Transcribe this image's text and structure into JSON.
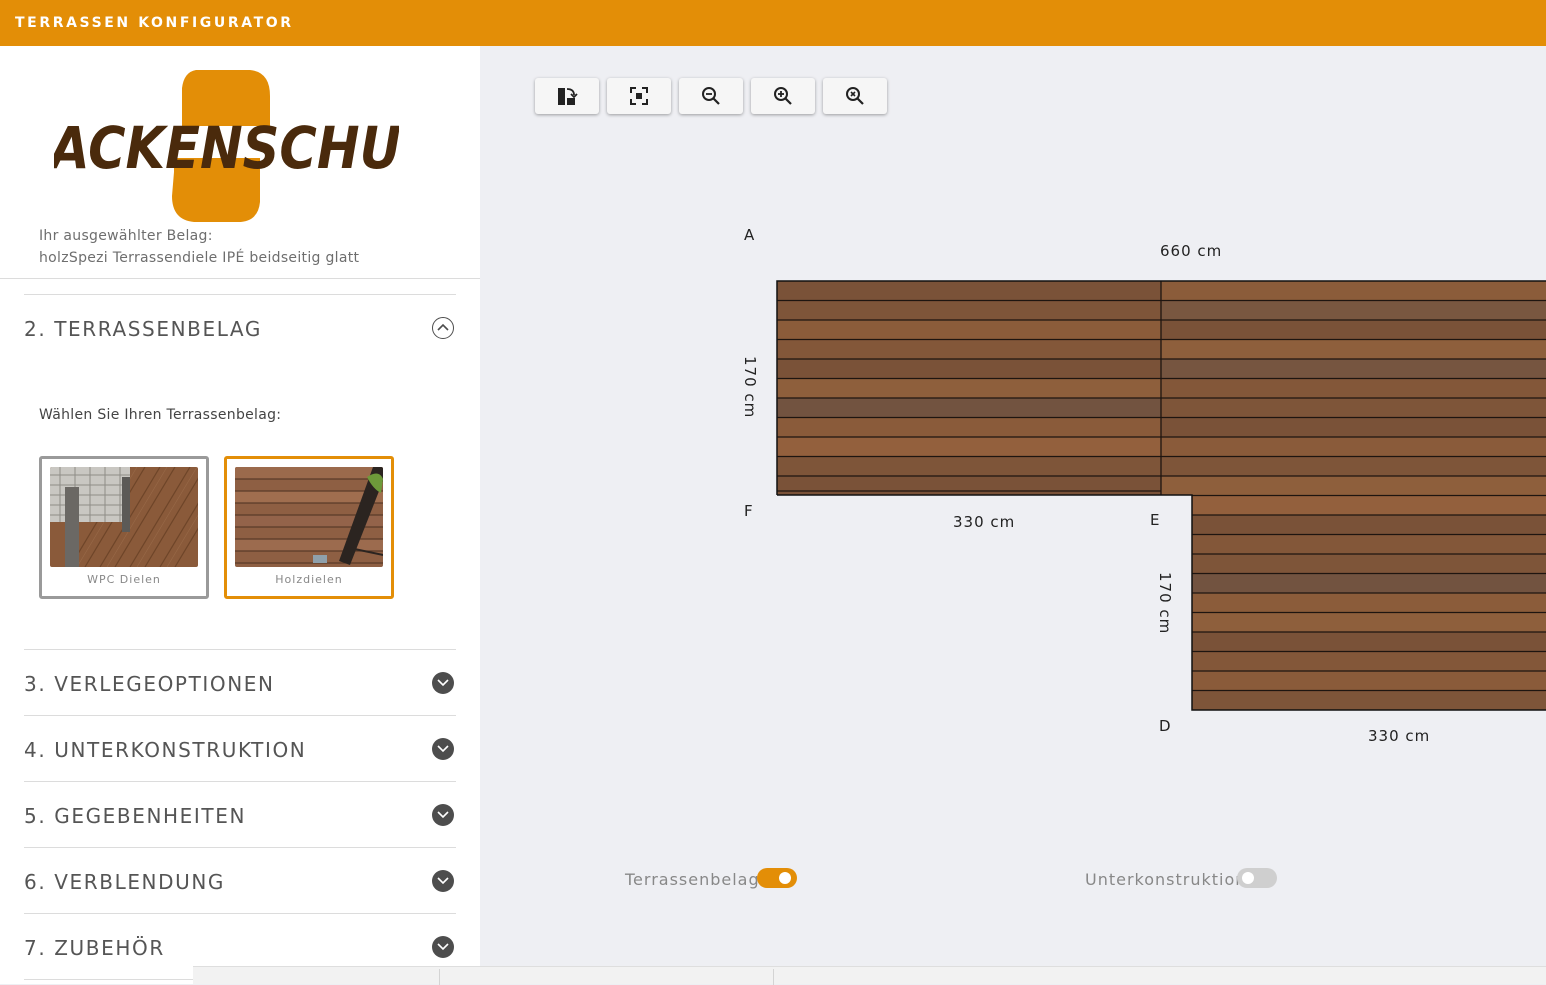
{
  "app": {
    "title": "TERRASSEN KONFIGURATOR",
    "accent_color": "#e38e07"
  },
  "brand": {
    "logo_text": "HACKENSCHUH"
  },
  "selection": {
    "label": "Ihr ausgewählter Belag:",
    "value": "holzSpezi Terrassendiele IPÉ beidseitig glatt"
  },
  "accordion": {
    "open_section": {
      "title": "2. TERRASSENBELAG",
      "icon": "chevron-up-icon",
      "prompt": "Wählen Sie Ihren Terrassenbelag:",
      "options": [
        {
          "label": "WPC Dielen",
          "selected": false
        },
        {
          "label": "Holzdielen",
          "selected": true
        }
      ]
    },
    "sections": [
      {
        "title": "3. VERLEGEOPTIONEN",
        "icon": "chevron-down-icon"
      },
      {
        "title": "4. UNTERKONSTRUKTION",
        "icon": "chevron-down-icon"
      },
      {
        "title": "5. GEGEBENHEITEN",
        "icon": "chevron-down-icon"
      },
      {
        "title": "6. VERBLENDUNG",
        "icon": "chevron-down-icon"
      },
      {
        "title": "7. ZUBEHÖR",
        "icon": "chevron-down-icon"
      }
    ]
  },
  "toolbar": {
    "buttons": [
      "rotate-layout-icon",
      "fit-to-screen-icon",
      "zoom-out-icon",
      "zoom-in-icon",
      "zoom-reset-icon"
    ]
  },
  "plan": {
    "corners": {
      "a": "A",
      "d": "D",
      "e": "E",
      "f": "F"
    },
    "dimensions": {
      "top": "660 cm",
      "left": "170 cm",
      "inner_bottom": "330 cm",
      "inner_right": "170 cm",
      "bottom": "330 cm"
    }
  },
  "toggles": {
    "terrassenbelag": {
      "label": "Terrassenbelag",
      "on": true
    },
    "unterkonstruktion": {
      "label": "Unterkonstruktion",
      "on": false
    }
  }
}
